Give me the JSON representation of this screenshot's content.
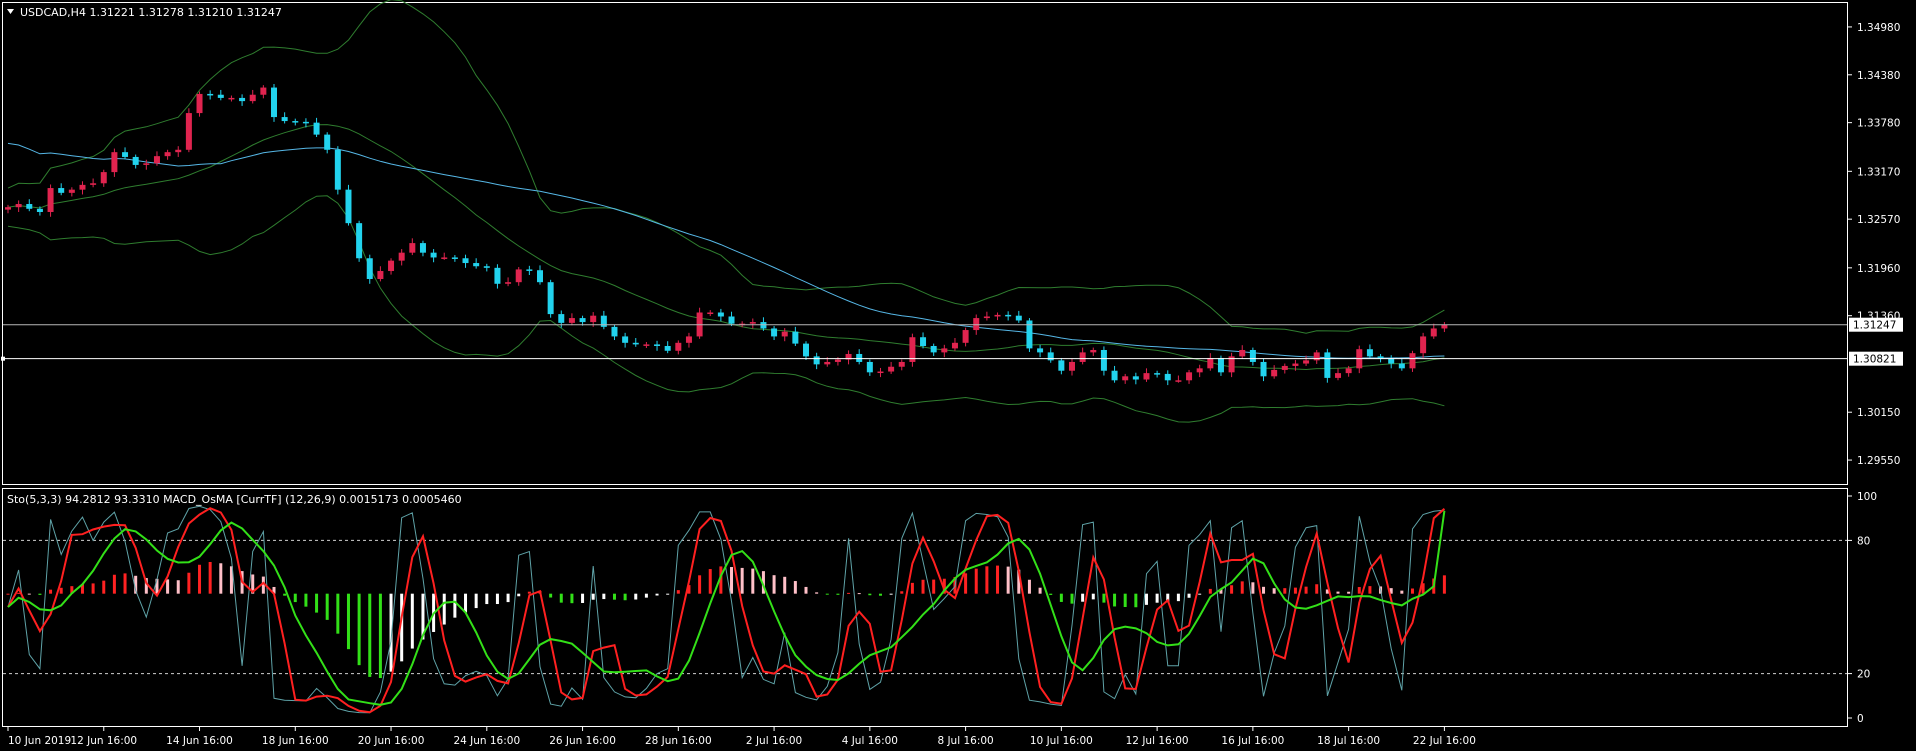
{
  "header": {
    "main_title": "USDCAD,H4  1.31221 1.31278 1.31210 1.31247",
    "sub_title": "Sto(5,3,3) 94.2812 93.3310  MACD_OsMA [CurrTF] (12,26,9) 0.0015173 0.0005460"
  },
  "colors": {
    "background": "#000000",
    "frame": "#ffffff",
    "bull_candle": "#e0244f",
    "bear_candle": "#22d3ee",
    "ma_line": "#56b7e6",
    "bands": "#2f7d2f",
    "sto_main": "#ff2020",
    "sto_signal": "#33e018",
    "osma_up_strong": "#ff2222",
    "osma_up_weak": "#ffc0c8",
    "osma_down_strong": "#32e018",
    "osma_down_weak": "#ffffff"
  },
  "chart_data": [
    {
      "type": "candlestick",
      "symbol": "USDCAD",
      "timeframe": "H4",
      "ohlc_last": {
        "open": 1.31221,
        "high": 1.31278,
        "low": 1.3121,
        "close": 1.31247
      },
      "y_ticks": [
        "1.34980",
        "1.34380",
        "1.33780",
        "1.33170",
        "1.32570",
        "1.31960",
        "1.31360",
        "1.30150",
        "1.29550"
      ],
      "ylim": [
        1.2925,
        1.3528
      ],
      "price_labels": [
        {
          "text": "1.31247",
          "value": 1.31247
        },
        {
          "text": "1.30821",
          "value": 1.30821
        }
      ],
      "closes": [
        1.3272,
        1.3276,
        1.327,
        1.3266,
        1.3296,
        1.329,
        1.3294,
        1.33,
        1.3302,
        1.3316,
        1.3341,
        1.3335,
        1.3325,
        1.3327,
        1.3336,
        1.3341,
        1.3344,
        1.339,
        1.3414,
        1.3413,
        1.3409,
        1.3409,
        1.3405,
        1.3413,
        1.3422,
        1.3385,
        1.338,
        1.3379,
        1.3378,
        1.3363,
        1.3344,
        1.3294,
        1.3252,
        1.3208,
        1.3182,
        1.3192,
        1.3205,
        1.3215,
        1.3227,
        1.3215,
        1.3209,
        1.3209,
        1.3208,
        1.3202,
        1.3198,
        1.3196,
        1.3176,
        1.3178,
        1.3194,
        1.3193,
        1.3178,
        1.3138,
        1.3127,
        1.3133,
        1.3128,
        1.3136,
        1.3122,
        1.311,
        1.3102,
        1.31,
        1.31,
        1.3098,
        1.3092,
        1.3102,
        1.311,
        1.314,
        1.314,
        1.3135,
        1.3126,
        1.3126,
        1.3128,
        1.312,
        1.311,
        1.3116,
        1.3101,
        1.3085,
        1.3075,
        1.3078,
        1.3081,
        1.3088,
        1.3078,
        1.3065,
        1.3066,
        1.3072,
        1.3078,
        1.3109,
        1.3098,
        1.309,
        1.3095,
        1.3102,
        1.3118,
        1.3133,
        1.3135,
        1.3137,
        1.3136,
        1.313,
        1.3095,
        1.309,
        1.308,
        1.3067,
        1.3078,
        1.309,
        1.3093,
        1.3067,
        1.3055,
        1.306,
        1.3056,
        1.3064,
        1.3063,
        1.3055,
        1.3055,
        1.3065,
        1.307,
        1.3083,
        1.3065,
        1.3085,
        1.3093,
        1.3078,
        1.306,
        1.3068,
        1.3073,
        1.3076,
        1.308,
        1.309,
        1.3058,
        1.3064,
        1.307,
        1.3094,
        1.3085,
        1.3082,
        1.3076,
        1.307,
        1.3089,
        1.311,
        1.312,
        1.3125
      ]
    },
    {
      "type": "oscillator",
      "name": "Sto(5,3,3) + MACD_OsMA",
      "ylim": [
        0,
        100
      ],
      "y_ticks": [
        "100",
        "80",
        "20",
        "0"
      ],
      "levels": [
        80,
        20
      ],
      "sto_main_end": 94.2812,
      "sto_signal_end": 93.331
    }
  ],
  "x_axis": {
    "labels": [
      "10 Jun 2019",
      "12 Jun 16:00",
      "14 Jun 16:00",
      "18 Jun 16:00",
      "20 Jun 16:00",
      "24 Jun 16:00",
      "26 Jun 16:00",
      "28 Jun 16:00",
      "2 Jul 16:00",
      "4 Jul 16:00",
      "8 Jul 16:00",
      "10 Jul 16:00",
      "12 Jul 16:00",
      "16 Jul 16:00",
      "18 Jul 16:00",
      "22 Jul 16:00"
    ]
  }
}
